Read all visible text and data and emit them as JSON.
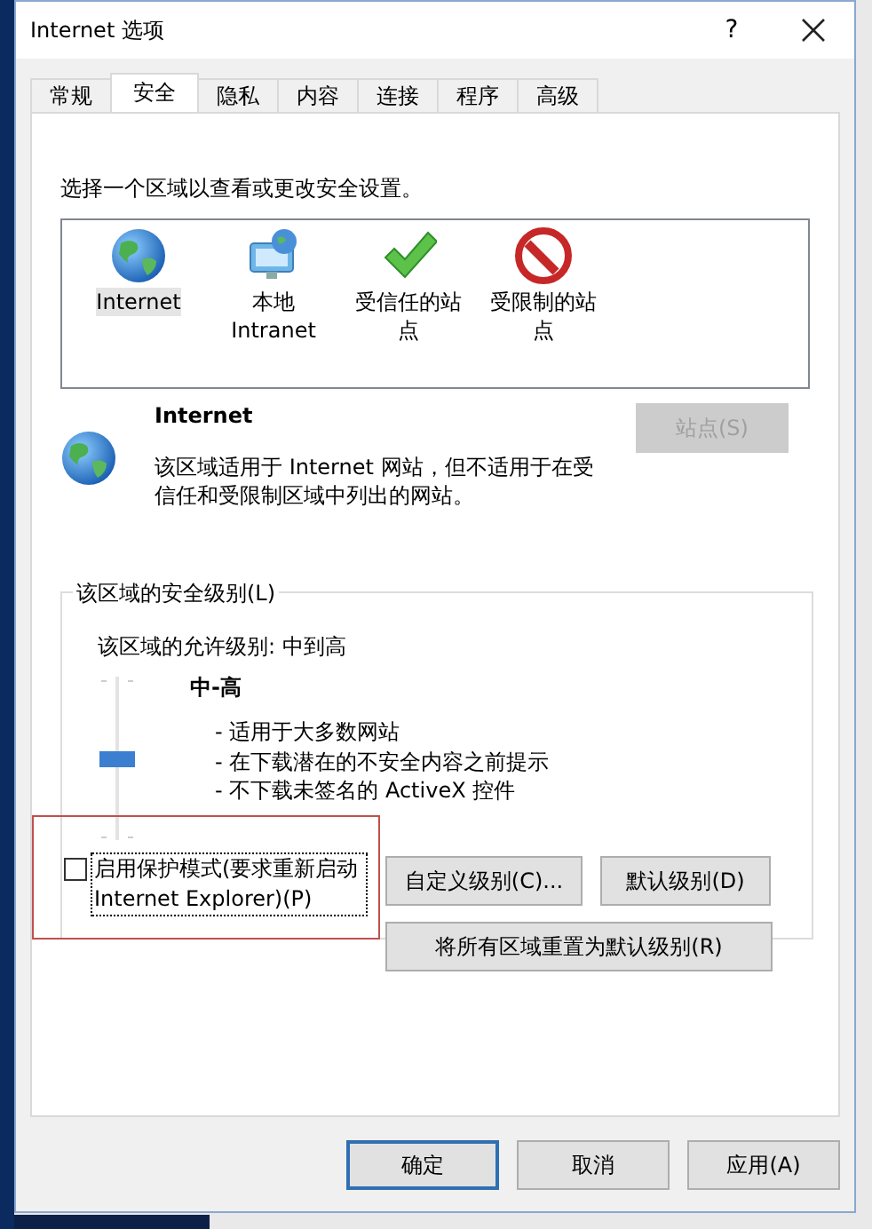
{
  "window": {
    "title": "Internet 选项",
    "help_button": "?"
  },
  "tabs": [
    {
      "label": "常规",
      "selected": false
    },
    {
      "label": "安全",
      "selected": true
    },
    {
      "label": "隐私",
      "selected": false
    },
    {
      "label": "内容",
      "selected": false
    },
    {
      "label": "连接",
      "selected": false
    },
    {
      "label": "程序",
      "selected": false
    },
    {
      "label": "高级",
      "selected": false
    }
  ],
  "zone_prompt": "选择一个区域以查看或更改安全设置。",
  "zones": [
    {
      "kind": "internet",
      "label": "Internet",
      "selected": true
    },
    {
      "kind": "intranet",
      "label": "本地 Intranet",
      "selected": false
    },
    {
      "kind": "trusted",
      "label": "受信任的站点",
      "selected": false
    },
    {
      "kind": "restricted",
      "label": "受限制的站点",
      "selected": false
    }
  ],
  "zone_detail": {
    "title": "Internet",
    "description": "该区域适用于 Internet 网站，但不适用于在受信任和受限制区域中列出的网站。",
    "sites_button": {
      "label": "站点(S)",
      "disabled": true
    }
  },
  "security_level": {
    "legend": "该区域的安全级别(L)",
    "allowed": "该区域的允许级别: 中到高",
    "slider": {
      "level": 0.5,
      "disabled": true
    },
    "level_name": "中-高",
    "bullets": [
      "- 适用于大多数网站",
      "- 在下载潜在的不安全内容之前提示",
      "- 不下载未签名的 ActiveX 控件"
    ]
  },
  "protected_mode": {
    "label": "启用保护模式(要求重新启动 Internet Explorer)(P)",
    "checked": false,
    "highlighted": true
  },
  "custom_level_button": "自定义级别(C)...",
  "default_level_button": "默认级别(D)",
  "reset_all_button": "将所有区域重置为默认级别(R)",
  "buttons": [
    {
      "label": "确定",
      "default": true
    },
    {
      "label": "取消",
      "default": false
    },
    {
      "label": "应用(A)",
      "default": false
    }
  ]
}
